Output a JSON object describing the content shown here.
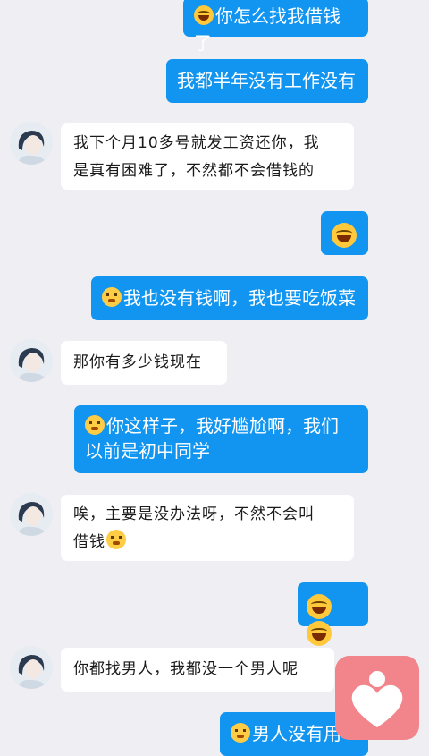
{
  "messages": [
    {
      "side": "right",
      "emoji": "laugh",
      "text": "你怎么找我借钱了"
    },
    {
      "side": "right",
      "emoji": "",
      "text": "我都半年没有工作没有"
    },
    {
      "side": "left",
      "lines": [
        "我下个月10多号就发工资还你，我",
        "是真有困难了，不然都不会借钱的"
      ]
    },
    {
      "side": "right",
      "emoji": "laugh-big",
      "text": ""
    },
    {
      "side": "right",
      "emoji": "face",
      "text": "我也没有钱啊，我也要吃饭菜"
    },
    {
      "side": "left",
      "lines": [
        "那你有多少钱现在"
      ]
    },
    {
      "side": "right",
      "emoji": "face",
      "lines": [
        "你这样子，我好尴尬啊，我们",
        "以前是初中同学"
      ]
    },
    {
      "side": "left",
      "lines": [
        "唉，主要是没办法呀，不然不会叫",
        "借钱"
      ],
      "emoji_end": "face"
    },
    {
      "side": "right",
      "emoji": "laugh-big-double",
      "text": ""
    },
    {
      "side": "left",
      "lines": [
        "你都找男人，我都没一个男人呢"
      ]
    },
    {
      "side": "right",
      "emoji": "face",
      "text": "男人没有用"
    }
  ],
  "colors": {
    "bubble_right": "#1195f0",
    "bubble_left": "#ffffff",
    "background": "#eeeef3",
    "fab": "#f2848b"
  },
  "icons": {
    "laugh": "tears-of-joy-emoji",
    "face": "awkward-face-emoji",
    "avatar": "contact-avatar",
    "fab": "heart-person-icon"
  }
}
